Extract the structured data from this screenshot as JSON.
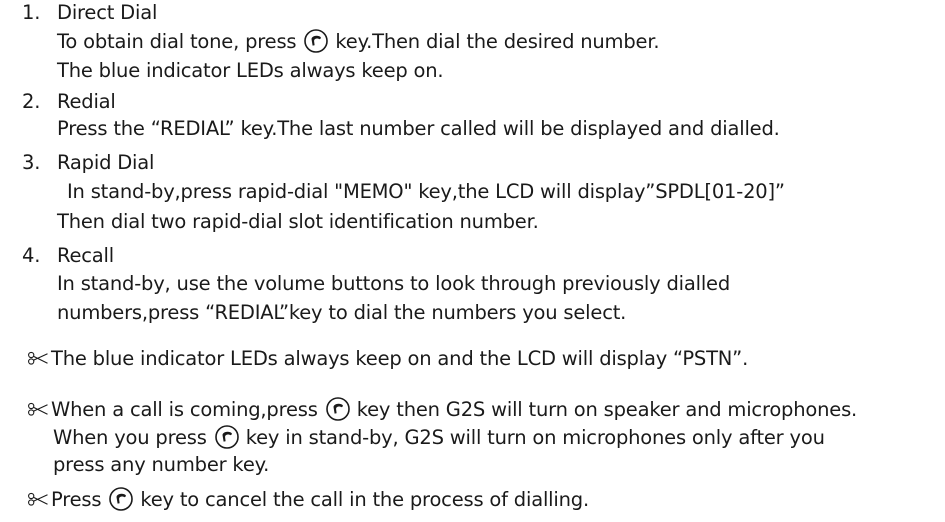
{
  "steps": [
    {
      "number": "1.",
      "title": "Direct Dial",
      "line1_before": "To obtain dial tone, press",
      "line1_after": "key.Then dial the desired number.",
      "line2": "The blue indicator LEDs always keep on."
    },
    {
      "number": "2.",
      "title": "Redial",
      "line1": "Press the “REDIAL” key.The last number called will be displayed and dialled."
    },
    {
      "number": "3.",
      "title": "Rapid Dial",
      "line1": "In stand-by,press rapid-dial \"MEMO\" key,the LCD will display”SPDL[01-20]”",
      "line2": "Then dial two rapid-dial slot identification number."
    },
    {
      "number": "4.",
      "title": "Recall",
      "line1": "In stand-by, use the volume buttons to look through previously dialled",
      "line2": "numbers,press “REDIAL”key to dial the numbers you select."
    }
  ],
  "notes": [
    {
      "line1": "The blue indicator LEDs always keep on and the LCD will display “PSTN”."
    },
    {
      "line1_before": "When a call is coming,press",
      "line1_after": "key then G2S will turn on speaker and microphones.",
      "line2_before": "When you press",
      "line2_after": "key in stand-by, G2S will turn on microphones only after you",
      "line3": "press any number key."
    },
    {
      "line1_before": "Press",
      "line1_after": "key to cancel the call in the process of dialling."
    }
  ],
  "icons": {
    "handset": "handset-key-icon",
    "note": "scissors-icon"
  }
}
